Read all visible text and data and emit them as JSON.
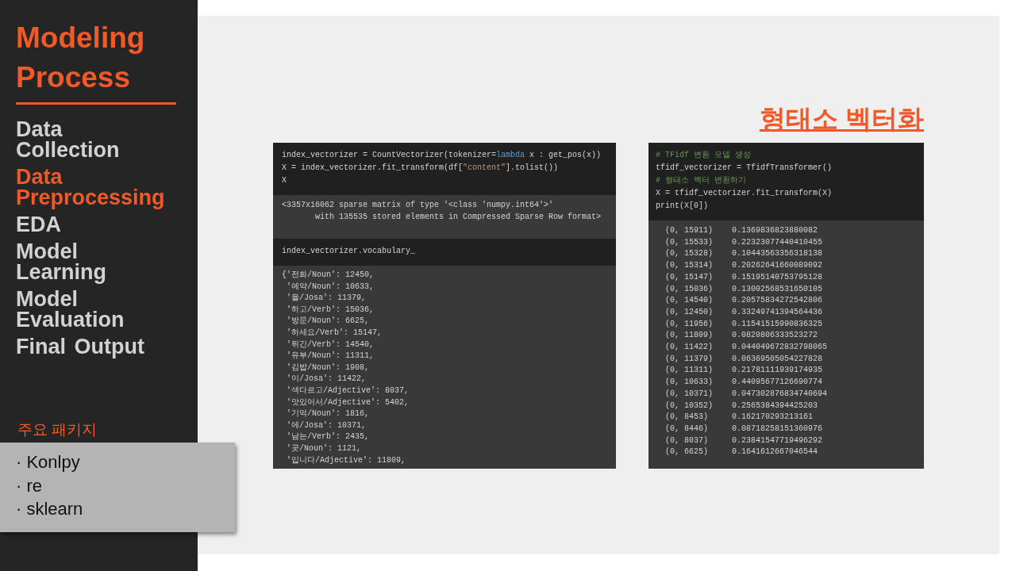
{
  "sidebar": {
    "title": "Modeling Process",
    "items": [
      {
        "label": "Data Collection",
        "selected": false
      },
      {
        "label": "Data Preprocessing",
        "selected": true
      },
      {
        "label": "EDA",
        "selected": false
      },
      {
        "label": "Model Learning",
        "selected": false
      },
      {
        "label": "Model Evaluation",
        "selected": false
      },
      {
        "label": "Final Output",
        "selected": false
      }
    ],
    "packages": {
      "heading": "주요 패키지",
      "items": [
        "· Konlpy",
        "· re",
        "· sklearn"
      ]
    }
  },
  "notebooks": [
    {
      "cells": [
        {
          "kind": "input",
          "lines": [
            [
              {
                "kind": "plain",
                "text": "index_vectorizer = CountVectorizer(tokenizer="
              },
              {
                "kind": "keyword",
                "text": "lambda"
              },
              {
                "kind": "plain",
                "text": " x : get_pos(x))"
              }
            ],
            [
              {
                "kind": "plain",
                "text": "X = index_vectorizer.fit_transform(df["
              },
              {
                "kind": "string",
                "text": "\"content\""
              },
              {
                "kind": "plain",
                "text": "].tolist())"
              }
            ],
            [
              {
                "kind": "plain",
                "text": "X"
              }
            ]
          ]
        },
        {
          "kind": "repr",
          "lines": [
            "<3357x16062 sparse matrix of type '<class 'numpy.int64'>'",
            "with 135535 stored elements in Compressed Sparse Row format>"
          ]
        },
        {
          "kind": "input",
          "lines": [
            [
              {
                "kind": "plain",
                "text": "index_vectorizer.vocabulary_"
              }
            ]
          ]
        },
        {
          "kind": "dict",
          "lines": [
            "{'전화/Noun': 12450,",
            "'예약/Noun': 10633,",
            "'을/Josa': 11379,",
            "'하고/Verb': 15036,",
            "'방문/Noun': 6625,",
            "'하세요/Verb': 15147,",
            "'튀긴/Verb': 14540,",
            "'유부/Noun': 11311,",
            "'김밥/Noun': 1908,",
            "'이/Josa': 11422,",
            "'색다르고/Adjective': 8037,",
            "'맛있어서/Adjective': 5402,",
            "'기억/Noun': 1816,",
            "'에/Josa': 10371,",
            "'남는/Verb': 2435,",
            "'곳/Noun': 1121,",
            "'입니다/Adjective': 11809,"
          ]
        }
      ]
    },
    {
      "title": "형태소 벡터화",
      "cells": [
        {
          "kind": "input",
          "lines": [
            [
              {
                "kind": "comment",
                "text": "# TFidf 변환 모델 생성"
              }
            ],
            [
              {
                "kind": "plain",
                "text": "tfidf_vectorizer = TfidfTransformer()"
              }
            ],
            [
              {
                "kind": "comment",
                "text": "# 형태소 벡터 변환하기"
              }
            ],
            [
              {
                "kind": "plain",
                "text": "X = tfidf_vectorizer.fit_transform(X)"
              }
            ],
            [
              {
                "kind": "plain",
                "text": "print(X[0])"
              }
            ]
          ]
        },
        {
          "kind": "sparse",
          "rows": [
            {
              "index": "(0, 15911)",
              "value": "0.1369836823880082"
            },
            {
              "index": "(0, 15533)",
              "value": "0.22323077440410455"
            },
            {
              "index": "(0, 15328)",
              "value": "0.10443563356318138"
            },
            {
              "index": "(0, 15314)",
              "value": "0.20262641660089092"
            },
            {
              "index": "(0, 15147)",
              "value": "0.15195140753795128"
            },
            {
              "index": "(0, 15036)",
              "value": "0.13002568531650105"
            },
            {
              "index": "(0, 14540)",
              "value": "0.20575834272542806"
            },
            {
              "index": "(0, 12450)",
              "value": "0.33249741394564436"
            },
            {
              "index": "(0, 11956)",
              "value": "0.11541515990836325"
            },
            {
              "index": "(0, 11809)",
              "value": "0.0820806333523272"
            },
            {
              "index": "(0, 11422)",
              "value": "0.044049672832798065"
            },
            {
              "index": "(0, 11379)",
              "value": "0.06369505054227828"
            },
            {
              "index": "(0, 11311)",
              "value": "0.21781111939174935"
            },
            {
              "index": "(0, 10633)",
              "value": "0.44095677126690774"
            },
            {
              "index": "(0, 10371)",
              "value": "0.047302876834740694"
            },
            {
              "index": "(0, 10352)",
              "value": "0.2565384394425203"
            },
            {
              "index": "(0, 8453)",
              "value": "0.162170293213161"
            },
            {
              "index": "(0, 8446)",
              "value": "0.08718258151360976"
            },
            {
              "index": "(0, 8037)",
              "value": "0.23841547719496292"
            },
            {
              "index": "(0, 6625)",
              "value": "0.1641612667046544"
            }
          ]
        }
      ]
    }
  ]
}
